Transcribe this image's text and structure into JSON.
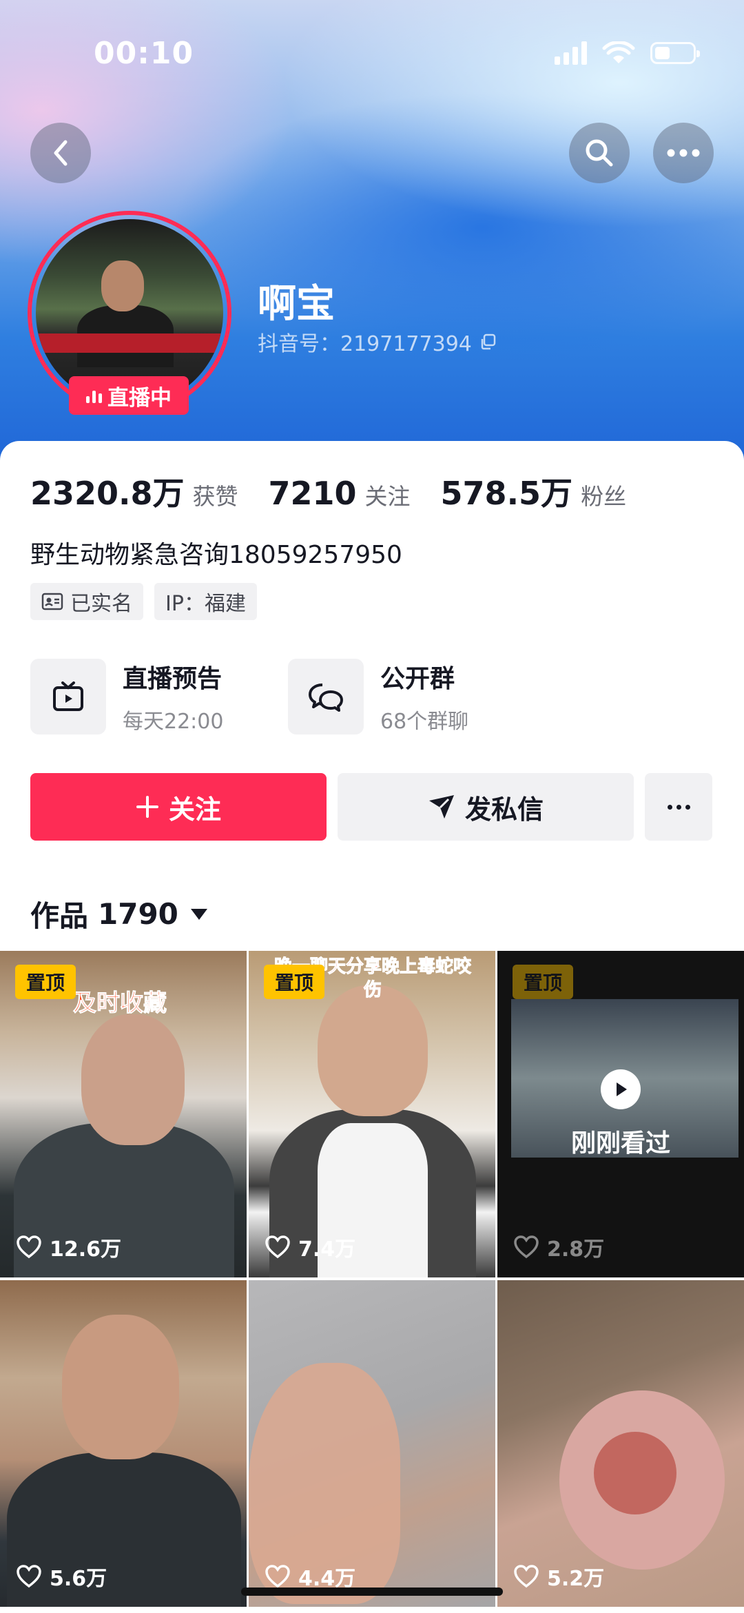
{
  "status_bar": {
    "time": "00:10"
  },
  "profile": {
    "name": "啊宝",
    "douyin_id": "抖音号：2197177394",
    "live_badge": "直播中"
  },
  "stats": [
    {
      "value": "2320.8万",
      "label": "获赞"
    },
    {
      "value": "7210",
      "label": "关注"
    },
    {
      "value": "578.5万",
      "label": "粉丝"
    }
  ],
  "bio": "野生动物紧急咨询18059257950",
  "tags": [
    {
      "icon": "id-card-icon",
      "label": "已实名"
    },
    {
      "label": "IP：福建"
    }
  ],
  "features": [
    {
      "icon": "tv-icon",
      "title": "直播预告",
      "subtitle": "每天22:00"
    },
    {
      "icon": "chat-bubbles-icon",
      "title": "公开群",
      "subtitle": "68个群聊"
    }
  ],
  "actions": {
    "follow": "关注",
    "message": "发私信"
  },
  "works_tab": {
    "label": "作品",
    "count": "1790"
  },
  "videos": [
    {
      "pinned": "置顶",
      "overlay": "及时收藏",
      "likes": "12.6万"
    },
    {
      "pinned": "置顶",
      "overlay": "晚一聊天分享晚上毒蛇咬伤",
      "likes": "7.4万"
    },
    {
      "pinned": "置顶",
      "overlay": "刚刚看过",
      "likes": "2.8万"
    },
    {
      "likes": "5.6万"
    },
    {
      "likes": "4.4万"
    },
    {
      "likes": "5.2万"
    }
  ],
  "colors": {
    "accent": "#fe2c55",
    "pin": "#ffc300"
  }
}
